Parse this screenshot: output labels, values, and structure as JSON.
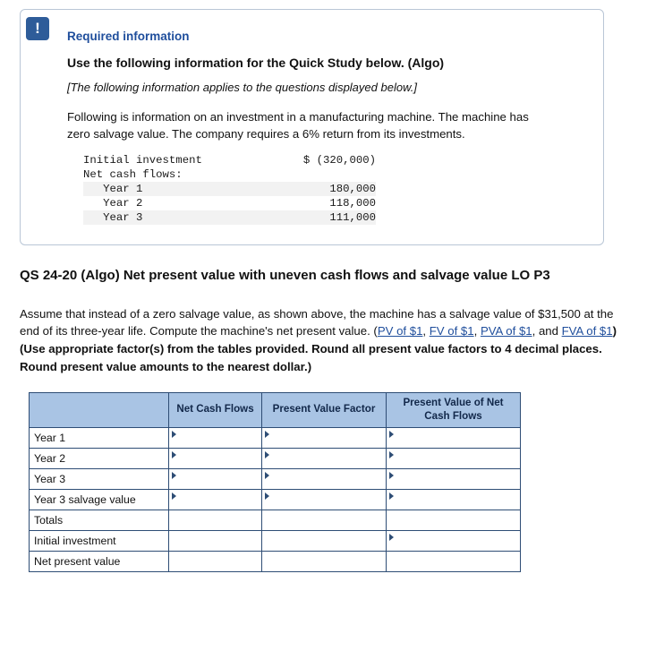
{
  "required_info": {
    "icon": "exclamation-icon",
    "title": "Required information",
    "subtitle": "Use the following information for the Quick Study below. (Algo)",
    "applies_note": "[The following information applies to the questions displayed below.]",
    "paragraph": "Following is information on an investment in a manufacturing machine. The machine has zero salvage value. The company requires a 6% return from its investments.",
    "data_table": [
      {
        "label": "Initial investment",
        "value": "$ (320,000)",
        "shaded": false
      },
      {
        "label": "Net cash flows:",
        "value": "",
        "shaded": false
      },
      {
        "label": "   Year 1",
        "value": "180,000",
        "shaded": true
      },
      {
        "label": "   Year 2",
        "value": "118,000",
        "shaded": false
      },
      {
        "label": "   Year 3",
        "value": "111,000",
        "shaded": true
      }
    ]
  },
  "question": {
    "heading": "QS 24-20 (Algo) Net present value with uneven cash flows and salvage value LO P3",
    "body_part1": "Assume that instead of a zero salvage value, as shown above, the machine has a salvage value of $31,500 at the end of its three-year life. Compute the machine's net present value. (",
    "link1": "PV of $1",
    "comma1": ", ",
    "link2": "FV of $1",
    "comma2": ", ",
    "link3": "PVA of $1",
    "comma3": ", and ",
    "link4": "FVA of $1",
    "body_bold": ") (Use appropriate factor(s) from the tables provided. Round all present value factors to 4 decimal places. Round present value amounts to the nearest dollar.)"
  },
  "answer_table": {
    "headers": [
      "",
      "Net Cash Flows",
      "Present Value Factor",
      "Present Value of Net Cash Flows"
    ],
    "rows": [
      {
        "label": "Year 1",
        "cells": [
          "input",
          "input",
          "input"
        ]
      },
      {
        "label": "Year 2",
        "cells": [
          "input",
          "input",
          "input"
        ]
      },
      {
        "label": "Year 3",
        "cells": [
          "input",
          "input",
          "input"
        ]
      },
      {
        "label": "Year 3 salvage value",
        "cells": [
          "input",
          "input",
          "input"
        ]
      },
      {
        "label": "Totals",
        "cells": [
          "blank",
          "none",
          "blank"
        ]
      },
      {
        "label": "Initial investment",
        "cells": [
          "blank",
          "none",
          "input"
        ]
      },
      {
        "label": "Net present value",
        "cells": [
          "blank",
          "none",
          "blank"
        ]
      }
    ]
  },
  "colors": {
    "accent_blue": "#1f4e9c",
    "header_fill": "#a9c4e4",
    "border": "#2e4d75",
    "icon_bg": "#2e5c99"
  }
}
